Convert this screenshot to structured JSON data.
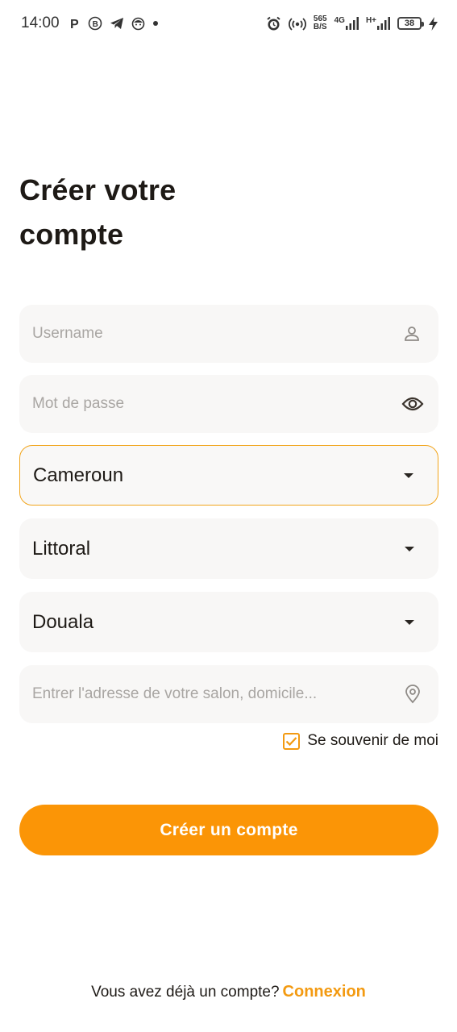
{
  "status_bar": {
    "time": "14:00",
    "net_speed_value": "565",
    "net_speed_unit": "B/S",
    "network_1": "4G",
    "network_2": "H+",
    "battery": "38",
    "icons": [
      "parking-icon",
      "b-app-icon",
      "telegram-icon",
      "face-app-icon",
      "dot-icon",
      "alarm-icon",
      "hotspot-icon",
      "signal-icon",
      "signal-icon",
      "battery-icon",
      "charging-icon"
    ]
  },
  "header": {
    "title_line1": "Créer votre",
    "title_line2": "compte"
  },
  "form": {
    "username_placeholder": "Username",
    "password_placeholder": "Mot de passe",
    "country_value": "Cameroun",
    "region_value": "Littoral",
    "city_value": "Douala",
    "address_placeholder": "Entrer l'adresse de votre salon, domicile...",
    "remember_label": "Se souvenir de moi",
    "remember_checked": true
  },
  "actions": {
    "submit_label": "Créer un compte"
  },
  "footer": {
    "prompt": "Vous avez déjà un compte?",
    "login_label": "Connexion"
  },
  "colors": {
    "accent": "#fb9506",
    "accent_text": "#f39a11",
    "field_bg": "#f8f7f6",
    "focus_border": "#f2a51c",
    "text_dark": "#1e1a16",
    "placeholder": "#a9a6a3"
  }
}
